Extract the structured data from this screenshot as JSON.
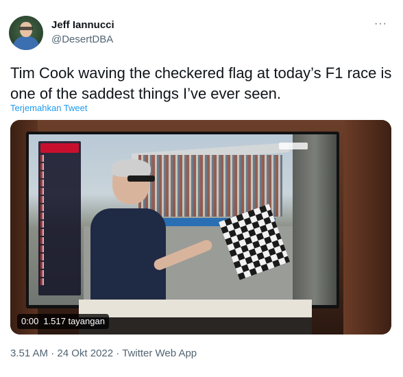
{
  "author": {
    "name": "Jeff Iannucci",
    "handle": "@DesertDBA"
  },
  "tweet": {
    "text": "Tim Cook waving the checkered flag at today’s F1 race is one of the saddest things I’ve ever seen.",
    "translate_label": "Terjemahkan Tweet"
  },
  "video": {
    "time": "0:00",
    "views": "1.517 tayangan"
  },
  "meta": {
    "time": "3.51 AM",
    "separator": " · ",
    "date": "24 Okt 2022",
    "source": "Twitter Web App"
  },
  "icons": {
    "more": "more-horizontal-icon"
  }
}
